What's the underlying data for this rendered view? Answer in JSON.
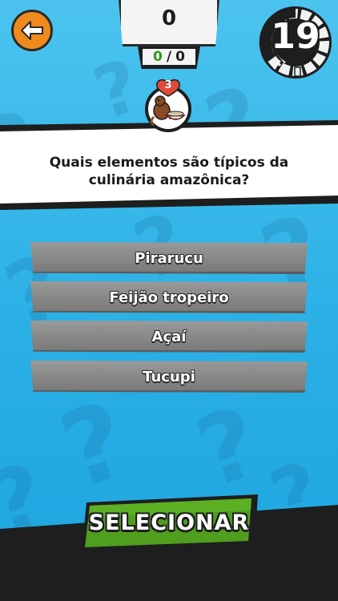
{
  "header": {
    "score": "0",
    "correct": "0",
    "separator": "/",
    "total": "0",
    "timer": "19"
  },
  "category": {
    "lives": "3",
    "icon": "monkey-with-food-bowl-icon"
  },
  "question": {
    "text": "Quais elementos são típicos da culinária amazônica?"
  },
  "answers": [
    {
      "label": "Pirarucu"
    },
    {
      "label": "Feijão tropeiro"
    },
    {
      "label": "Açaí"
    },
    {
      "label": "Tucupi"
    }
  ],
  "actions": {
    "select_label": "SELECIONAR"
  },
  "colors": {
    "background": "#2ab0e6",
    "back_button": "#f08a1c",
    "answer_button": "#8b8b8b",
    "select_button": "#4f9e1e",
    "correct_count": "#2e9a1c",
    "heart": "#e04a3a"
  }
}
